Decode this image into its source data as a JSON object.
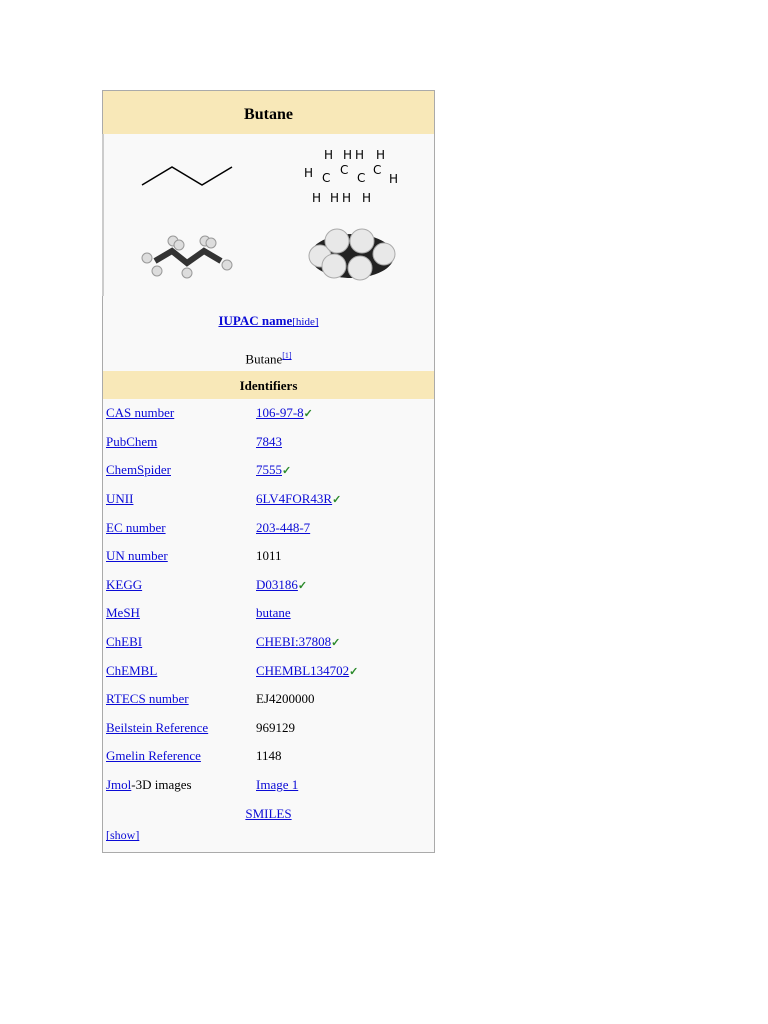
{
  "title": "Butane",
  "iupac": {
    "label": "IUPAC name",
    "hide": "[hide]",
    "value": "Butane",
    "ref": "[1]"
  },
  "identifiers_header": "Identifiers",
  "rows": [
    {
      "key": "CAS number",
      "value": "106-97-8",
      "link": true,
      "check": true
    },
    {
      "key": "PubChem",
      "value": "7843",
      "link": true,
      "check": false
    },
    {
      "key": "ChemSpider",
      "value": "7555",
      "link": true,
      "check": true
    },
    {
      "key": "UNII",
      "value": "6LV4FOR43R",
      "link": true,
      "check": true
    },
    {
      "key": "EC number",
      "value": "203-448-7",
      "link": true,
      "check": false
    },
    {
      "key": "UN number",
      "value": "1011",
      "link": false,
      "check": false
    },
    {
      "key": "KEGG",
      "value": "D03186",
      "link": true,
      "check": true
    },
    {
      "key": "MeSH",
      "value": "butane",
      "link": true,
      "check": false
    },
    {
      "key": "ChEBI",
      "value": "CHEBI:37808",
      "link": true,
      "check": true
    },
    {
      "key": "ChEMBL",
      "value": "CHEMBL134702",
      "link": true,
      "check": true
    },
    {
      "key": "RTECS number",
      "value": "EJ4200000",
      "link": false,
      "check": false
    },
    {
      "key": "Beilstein Reference",
      "value": "969129",
      "link": false,
      "check": false
    },
    {
      "key": "Gmelin Reference",
      "value": "1148",
      "link": false,
      "check": false
    }
  ],
  "jmol": {
    "link": "Jmol",
    "suffix": "-3D images",
    "value": "Image 1"
  },
  "smiles": "SMILES",
  "show": "[show]",
  "check_glyph": "✓"
}
